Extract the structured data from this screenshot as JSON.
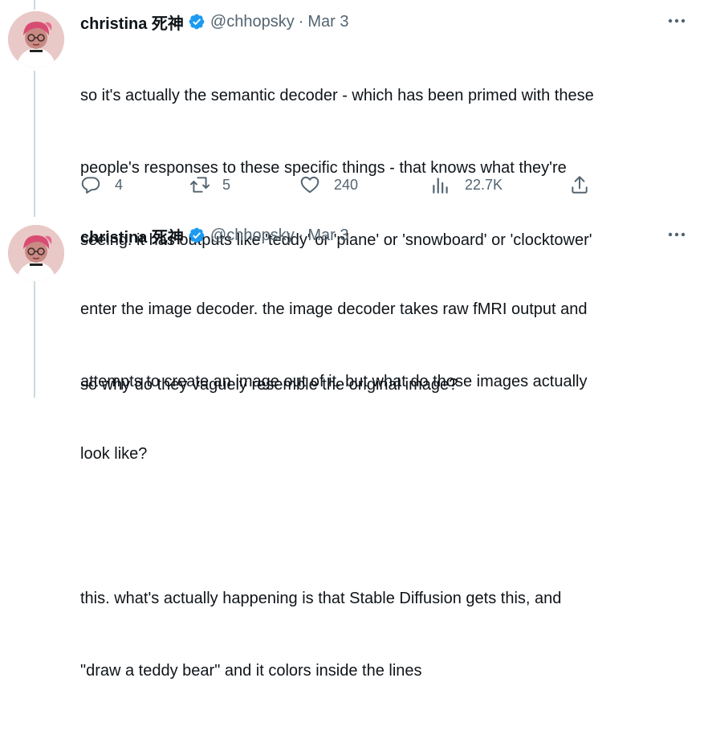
{
  "tweets": [
    {
      "author_name": "christina 死神",
      "handle": "@chhopsky",
      "separator": "·",
      "date": "Mar 3",
      "text_lines": [
        "so it's actually the semantic decoder - which has been primed with these",
        "people's responses to these specific things - that knows what they're",
        "seeing. it has outputs like 'teddy' or 'plane' or 'snowboard' or 'clocktower'",
        "",
        "so why do they vaguely resemble the original image?"
      ],
      "actions": {
        "replies": "4",
        "retweets": "5",
        "likes": "240",
        "views": "22.7K"
      }
    },
    {
      "author_name": "christina 死神",
      "handle": "@chhopsky",
      "separator": "·",
      "date": "Mar 3",
      "text_lines": [
        "enter the image decoder. the image decoder takes raw fMRI output and",
        "attempts to create an image out of it. but what do those images actually",
        "look like?",
        "",
        "this. what's actually happening is that Stable Diffusion gets this, and",
        "\"draw a teddy bear\" and it colors inside the lines"
      ]
    }
  ],
  "icons": {
    "verified": "verified-badge-icon",
    "more": "more-dots-icon",
    "reply": "reply-icon",
    "retweet": "retweet-icon",
    "like": "heart-icon",
    "views": "views-bar-chart-icon",
    "share": "share-icon"
  },
  "colors": {
    "verified": "#1d9bf0",
    "secondary_text": "#536471",
    "thread_line": "#cfd9de"
  }
}
